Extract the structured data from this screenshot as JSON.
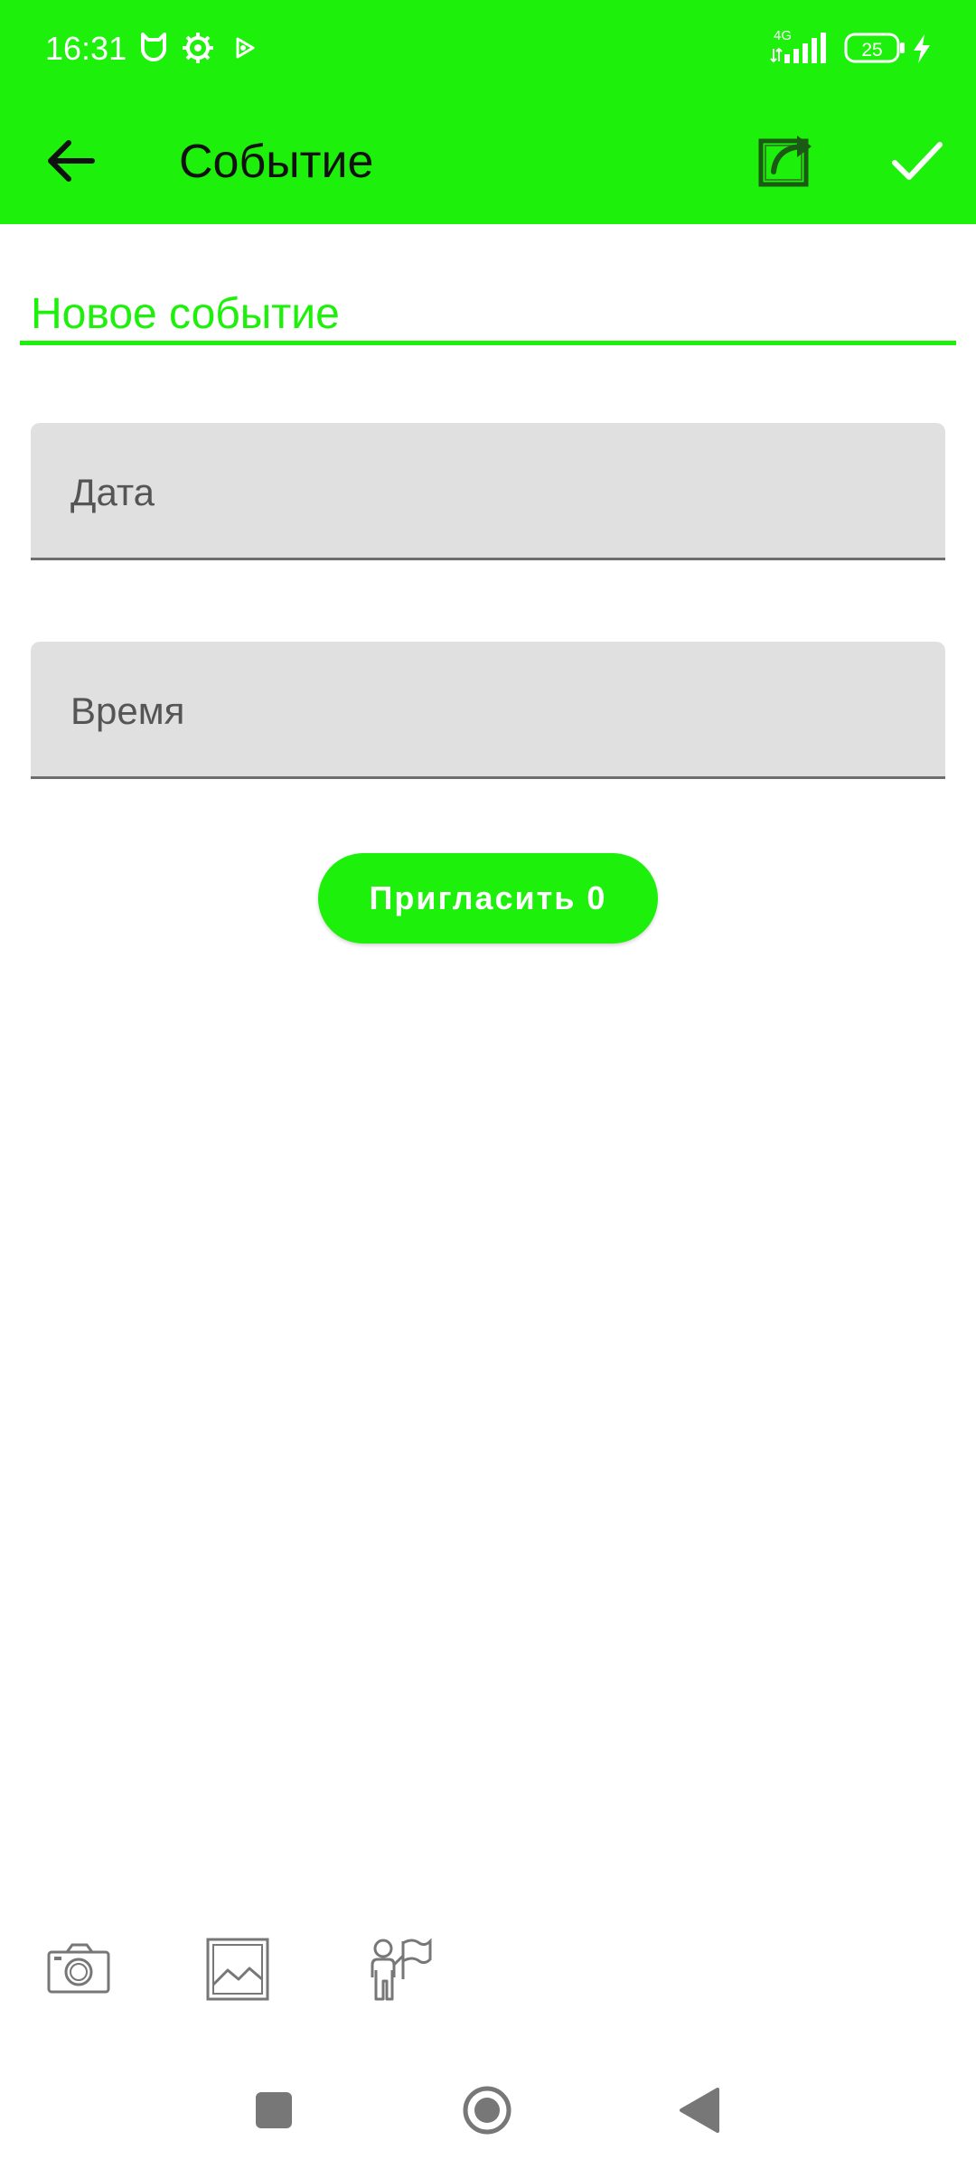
{
  "status_bar": {
    "time": "16:31",
    "network": "4G",
    "battery": "25",
    "icons": [
      "cat-icon",
      "gear-icon",
      "play-icon",
      "signal-icon",
      "battery-icon",
      "charging-icon"
    ]
  },
  "app_bar": {
    "title": "Событие",
    "icons": [
      "back-arrow-icon",
      "share-icon",
      "check-icon"
    ]
  },
  "form": {
    "title_value": "Новое событие",
    "date_placeholder": "Дата",
    "time_placeholder": "Время",
    "invite_label": "Пригласить 0"
  },
  "toolbar": {
    "icons": [
      "camera-icon",
      "image-icon",
      "person-flag-icon"
    ]
  },
  "nav_bar": {
    "icons": [
      "recent-apps-icon",
      "home-icon",
      "back-icon"
    ]
  },
  "colors": {
    "accent": "#1df00a",
    "field_bg": "#e0e0e0",
    "label": "#555555",
    "icon_gray": "#777777"
  }
}
